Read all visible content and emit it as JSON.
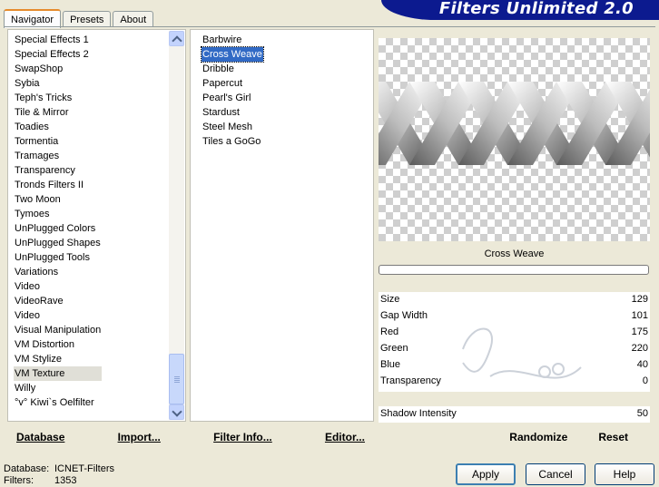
{
  "tabs": [
    "Navigator",
    "Presets",
    "About"
  ],
  "banner": "Filters Unlimited 2.0",
  "categories": [
    "Special Effects 1",
    "Special Effects 2",
    "SwapShop",
    "Sybia",
    "Teph's Tricks",
    "Tile & Mirror",
    "Toadies",
    "Tormentia",
    "Tramages",
    "Transparency",
    "Tronds Filters II",
    "Two Moon",
    "Tymoes",
    "UnPlugged Colors",
    "UnPlugged Shapes",
    "UnPlugged Tools",
    "Variations",
    "Video",
    "VideoRave",
    "Video",
    "Visual Manipulation",
    "VM Distortion",
    "VM Stylize",
    "VM Texture",
    "Willy",
    "°v° Kiwi`s Oelfilter"
  ],
  "selected_category": "VM Texture",
  "filters": [
    "Barbwire",
    "Cross Weave",
    "Dribble",
    "Papercut",
    "Pearl's Girl",
    "Stardust",
    "Steel Mesh",
    "Tiles a GoGo"
  ],
  "selected_filter": "Cross Weave",
  "preview_title": "Cross Weave",
  "params": [
    {
      "label": "Size",
      "value": "129"
    },
    {
      "label": "Gap Width",
      "value": "101"
    },
    {
      "label": "Red",
      "value": "175"
    },
    {
      "label": "Green",
      "value": "220"
    },
    {
      "label": "Blue",
      "value": "40"
    },
    {
      "label": "Transparency",
      "value": "0"
    }
  ],
  "extra_param": {
    "label": "Shadow Intensity",
    "value": "50"
  },
  "toolbar": {
    "database": "Database",
    "import": "Import...",
    "filter_info": "Filter Info...",
    "editor": "Editor...",
    "randomize": "Randomize",
    "reset": "Reset"
  },
  "status": {
    "database_label": "Database:",
    "database_value": "ICNET-Filters",
    "filters_label": "Filters:",
    "filters_value": "1353"
  },
  "buttons": {
    "apply": "Apply",
    "cancel": "Cancel",
    "help": "Help"
  },
  "colors": {
    "banner": "#0c1a8f",
    "selection": "#316ac5",
    "tab_accent": "#e68b2c"
  }
}
